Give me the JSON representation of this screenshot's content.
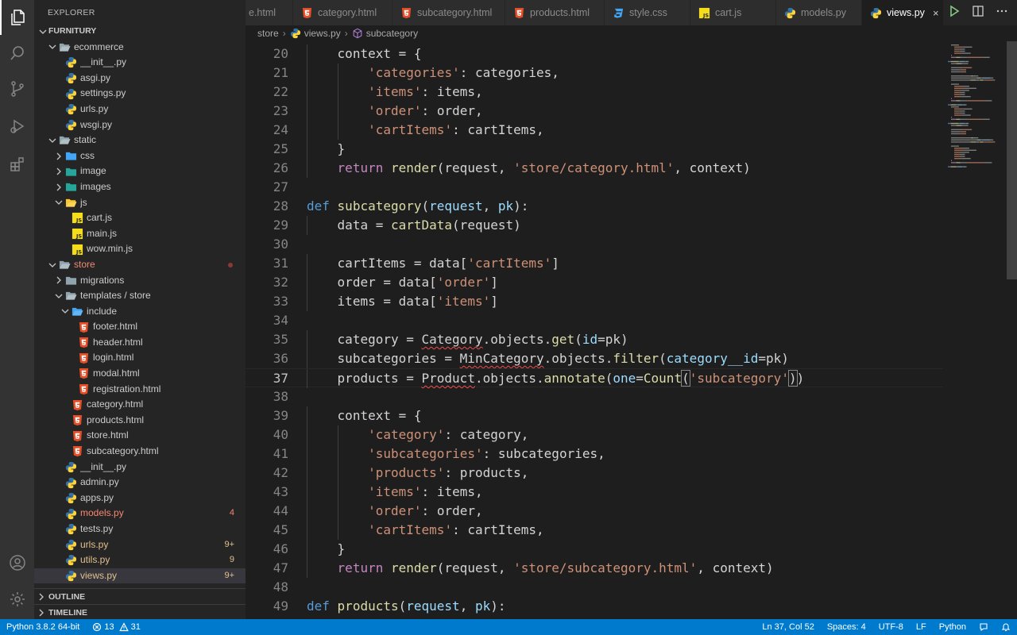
{
  "sidebar": {
    "title": "EXPLORER",
    "root": "FURNITURY",
    "tree": [
      {
        "label": "FURNITURY",
        "depth": 0,
        "type": "root",
        "open": true
      },
      {
        "label": "ecommerce",
        "depth": 1,
        "type": "folder",
        "open": true
      },
      {
        "label": "__init__.py",
        "depth": 2,
        "type": "py"
      },
      {
        "label": "asgi.py",
        "depth": 2,
        "type": "py"
      },
      {
        "label": "settings.py",
        "depth": 2,
        "type": "py"
      },
      {
        "label": "urls.py",
        "depth": 2,
        "type": "py"
      },
      {
        "label": "wsgi.py",
        "depth": 2,
        "type": "py"
      },
      {
        "label": "static",
        "depth": 1,
        "type": "folder",
        "open": true
      },
      {
        "label": "css",
        "depth": 2,
        "type": "folder-css",
        "open": false
      },
      {
        "label": "image",
        "depth": 2,
        "type": "folder-img",
        "open": false
      },
      {
        "label": "images",
        "depth": 2,
        "type": "folder-img",
        "open": false
      },
      {
        "label": "js",
        "depth": 2,
        "type": "folder-js",
        "open": true
      },
      {
        "label": "cart.js",
        "depth": 3,
        "type": "js"
      },
      {
        "label": "main.js",
        "depth": 3,
        "type": "js"
      },
      {
        "label": "wow.min.js",
        "depth": 3,
        "type": "js"
      },
      {
        "label": "store",
        "depth": 1,
        "type": "folder",
        "open": true,
        "status": "store",
        "dot": true
      },
      {
        "label": "migrations",
        "depth": 2,
        "type": "folder",
        "open": false
      },
      {
        "label": "templates / store",
        "depth": 2,
        "type": "folder",
        "open": true
      },
      {
        "label": "include",
        "depth": 3,
        "type": "folder-inc",
        "open": true
      },
      {
        "label": "footer.html",
        "depth": 4,
        "type": "html"
      },
      {
        "label": "header.html",
        "depth": 4,
        "type": "html"
      },
      {
        "label": "login.html",
        "depth": 4,
        "type": "html"
      },
      {
        "label": "modal.html",
        "depth": 4,
        "type": "html"
      },
      {
        "label": "registration.html",
        "depth": 4,
        "type": "html"
      },
      {
        "label": "category.html",
        "depth": 3,
        "type": "html"
      },
      {
        "label": "products.html",
        "depth": 3,
        "type": "html"
      },
      {
        "label": "store.html",
        "depth": 3,
        "type": "html"
      },
      {
        "label": "subcategory.html",
        "depth": 3,
        "type": "html"
      },
      {
        "label": "__init__.py",
        "depth": 2,
        "type": "py"
      },
      {
        "label": "admin.py",
        "depth": 2,
        "type": "py"
      },
      {
        "label": "apps.py",
        "depth": 2,
        "type": "py"
      },
      {
        "label": "models.py",
        "depth": 2,
        "type": "py",
        "status": "error",
        "badge": "4"
      },
      {
        "label": "tests.py",
        "depth": 2,
        "type": "py"
      },
      {
        "label": "urls.py",
        "depth": 2,
        "type": "py",
        "status": "modified",
        "badge": "9+"
      },
      {
        "label": "utils.py",
        "depth": 2,
        "type": "py",
        "status": "modified",
        "badge": "9"
      },
      {
        "label": "views.py",
        "depth": 2,
        "type": "py",
        "status": "modified",
        "badge": "9+",
        "selected": true
      }
    ],
    "outline_label": "OUTLINE",
    "timeline_label": "TIMELINE"
  },
  "tabs": [
    {
      "label": "e.html",
      "type": "none",
      "active": false
    },
    {
      "label": "category.html",
      "type": "html",
      "active": false
    },
    {
      "label": "subcategory.html",
      "type": "html",
      "active": false
    },
    {
      "label": "products.html",
      "type": "html",
      "active": false
    },
    {
      "label": "style.css",
      "type": "css",
      "active": false
    },
    {
      "label": "cart.js",
      "type": "js",
      "active": false
    },
    {
      "label": "models.py",
      "type": "py",
      "active": false
    },
    {
      "label": "views.py",
      "type": "py",
      "active": true
    }
  ],
  "tab_close": "×",
  "breadcrumb": {
    "folder": "store",
    "file": "views.py",
    "symbol": "subcategory",
    "sep": "›"
  },
  "editor": {
    "current_line": 37,
    "lines": [
      {
        "n": 20,
        "indent": 1,
        "tokens": [
          [
            "p",
            "context = {"
          ]
        ]
      },
      {
        "n": 21,
        "indent": 2,
        "tokens": [
          [
            "s",
            "'categories'"
          ],
          [
            "p",
            ": categories,"
          ]
        ]
      },
      {
        "n": 22,
        "indent": 2,
        "tokens": [
          [
            "s",
            "'items'"
          ],
          [
            "p",
            ": items,"
          ]
        ]
      },
      {
        "n": 23,
        "indent": 2,
        "tokens": [
          [
            "s",
            "'order'"
          ],
          [
            "p",
            ": order,"
          ]
        ]
      },
      {
        "n": 24,
        "indent": 2,
        "tokens": [
          [
            "s",
            "'cartItems'"
          ],
          [
            "p",
            ": cartItems,"
          ]
        ]
      },
      {
        "n": 25,
        "indent": 1,
        "tokens": [
          [
            "p",
            "}"
          ]
        ]
      },
      {
        "n": 26,
        "indent": 1,
        "tokens": [
          [
            "k",
            "return"
          ],
          [
            "p",
            " "
          ],
          [
            "f",
            "render"
          ],
          [
            "p",
            "(request, "
          ],
          [
            "s",
            "'store/category.html'"
          ],
          [
            "p",
            ", context)"
          ]
        ]
      },
      {
        "n": 27,
        "indent": 0,
        "tokens": []
      },
      {
        "n": 28,
        "indent": 0,
        "tokens": [
          [
            "d",
            "def"
          ],
          [
            "p",
            " "
          ],
          [
            "f",
            "subcategory"
          ],
          [
            "p",
            "("
          ],
          [
            "a",
            "request"
          ],
          [
            "p",
            ", "
          ],
          [
            "a",
            "pk"
          ],
          [
            "p",
            "):"
          ]
        ]
      },
      {
        "n": 29,
        "indent": 1,
        "tokens": [
          [
            "p",
            "data = "
          ],
          [
            "f",
            "cartData"
          ],
          [
            "p",
            "(request)"
          ]
        ]
      },
      {
        "n": 30,
        "indent": 0,
        "tokens": []
      },
      {
        "n": 31,
        "indent": 1,
        "tokens": [
          [
            "p",
            "cartItems = data["
          ],
          [
            "s",
            "'cartItems'"
          ],
          [
            "p",
            "]"
          ]
        ]
      },
      {
        "n": 32,
        "indent": 1,
        "tokens": [
          [
            "p",
            "order = data["
          ],
          [
            "s",
            "'order'"
          ],
          [
            "p",
            "]"
          ]
        ]
      },
      {
        "n": 33,
        "indent": 1,
        "tokens": [
          [
            "p",
            "items = data["
          ],
          [
            "s",
            "'items'"
          ],
          [
            "p",
            "]"
          ]
        ]
      },
      {
        "n": 34,
        "indent": 0,
        "tokens": []
      },
      {
        "n": 35,
        "indent": 1,
        "tokens": [
          [
            "p",
            "category = "
          ],
          [
            "q",
            "Category"
          ],
          [
            "p",
            ".objects."
          ],
          [
            "f",
            "get"
          ],
          [
            "p",
            "("
          ],
          [
            "a",
            "id"
          ],
          [
            "p",
            "=pk)"
          ]
        ]
      },
      {
        "n": 36,
        "indent": 1,
        "tokens": [
          [
            "p",
            "subcategories = "
          ],
          [
            "q",
            "MinCategory"
          ],
          [
            "p",
            ".objects."
          ],
          [
            "f",
            "filter"
          ],
          [
            "p",
            "("
          ],
          [
            "a",
            "category__id"
          ],
          [
            "p",
            "=pk)"
          ]
        ]
      },
      {
        "n": 37,
        "indent": 1,
        "tokens": [
          [
            "p",
            "products = "
          ],
          [
            "q",
            "Product"
          ],
          [
            "p",
            ".objects."
          ],
          [
            "f",
            "annotate"
          ],
          [
            "p",
            "("
          ],
          [
            "a",
            "one"
          ],
          [
            "p",
            "="
          ],
          [
            "f",
            "Count"
          ],
          [
            "b",
            "("
          ],
          [
            "s",
            "'subcategory'"
          ],
          [
            "b",
            ")"
          ],
          [
            "p",
            ")"
          ]
        ]
      },
      {
        "n": 38,
        "indent": 0,
        "tokens": []
      },
      {
        "n": 39,
        "indent": 1,
        "tokens": [
          [
            "p",
            "context = {"
          ]
        ]
      },
      {
        "n": 40,
        "indent": 2,
        "tokens": [
          [
            "s",
            "'category'"
          ],
          [
            "p",
            ": category,"
          ]
        ]
      },
      {
        "n": 41,
        "indent": 2,
        "tokens": [
          [
            "s",
            "'subcategories'"
          ],
          [
            "p",
            ": subcategories,"
          ]
        ]
      },
      {
        "n": 42,
        "indent": 2,
        "tokens": [
          [
            "s",
            "'products'"
          ],
          [
            "p",
            ": products,"
          ]
        ]
      },
      {
        "n": 43,
        "indent": 2,
        "tokens": [
          [
            "s",
            "'items'"
          ],
          [
            "p",
            ": items,"
          ]
        ]
      },
      {
        "n": 44,
        "indent": 2,
        "tokens": [
          [
            "s",
            "'order'"
          ],
          [
            "p",
            ": order,"
          ]
        ]
      },
      {
        "n": 45,
        "indent": 2,
        "tokens": [
          [
            "s",
            "'cartItems'"
          ],
          [
            "p",
            ": cartItems,"
          ]
        ]
      },
      {
        "n": 46,
        "indent": 1,
        "tokens": [
          [
            "p",
            "}"
          ]
        ]
      },
      {
        "n": 47,
        "indent": 1,
        "tokens": [
          [
            "k",
            "return"
          ],
          [
            "p",
            " "
          ],
          [
            "f",
            "render"
          ],
          [
            "p",
            "(request, "
          ],
          [
            "s",
            "'store/subcategory.html'"
          ],
          [
            "p",
            ", context)"
          ]
        ]
      },
      {
        "n": 48,
        "indent": 0,
        "tokens": []
      },
      {
        "n": 49,
        "indent": 0,
        "tokens": [
          [
            "d",
            "def"
          ],
          [
            "p",
            " "
          ],
          [
            "f",
            "products"
          ],
          [
            "p",
            "("
          ],
          [
            "a",
            "request"
          ],
          [
            "p",
            ", "
          ],
          [
            "a",
            "pk"
          ],
          [
            "p",
            "):"
          ]
        ]
      }
    ]
  },
  "status": {
    "python": "Python 3.8.2 64-bit",
    "errors": "13",
    "warnings": "31",
    "position": "Ln 37, Col 52",
    "spaces": "Spaces: 4",
    "encoding": "UTF-8",
    "eol": "LF",
    "language": "Python"
  },
  "colors": {
    "accent": "#007acc",
    "modified": "#e2c08d",
    "error": "#f48771",
    "html_icon": "#e44d26",
    "css_icon": "#42a5f5",
    "js_icon": "#f5de19",
    "py_blue": "#3572a5",
    "py_yellow": "#ffd43b"
  }
}
